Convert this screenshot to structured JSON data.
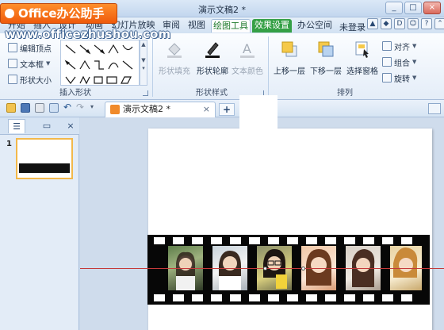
{
  "window": {
    "title": "演示文稿2 *",
    "controls": [
      "_",
      "□",
      "×"
    ]
  },
  "brand": {
    "logo": "Office办公助手",
    "watermark": "www.officezhushou.com"
  },
  "menu": {
    "tabs": [
      "开始",
      "插入",
      "设计",
      "动画",
      "幻灯片放映",
      "审阅",
      "视图",
      "绘图工具",
      "效果设置",
      "办公空间"
    ],
    "active": "绘图工具",
    "login": "未登录"
  },
  "ribbon": {
    "insert_shape": {
      "label": "插入形状",
      "buttons": [
        "编辑顶点",
        "文本框",
        "形状大小"
      ]
    },
    "shape_style": {
      "label": "形状样式",
      "buttons": [
        "形状填充",
        "形状轮廓",
        "文本颜色"
      ]
    },
    "arrange": {
      "label": "排列",
      "buttons": [
        "上移一层",
        "下移一层",
        "选择窗格"
      ],
      "small": [
        "对齐",
        "组合",
        "旋转"
      ]
    }
  },
  "document": {
    "tab": "演示文稿2 *",
    "close": "×",
    "new_tab": "+"
  },
  "slides_pane": {
    "tabs": [
      "☰",
      "▭",
      "×"
    ],
    "slide_number": "1"
  },
  "colors": {
    "accent_green": "#35a046",
    "logo_orange": "#ef5b0c",
    "selection_line": "#c43a3a"
  }
}
